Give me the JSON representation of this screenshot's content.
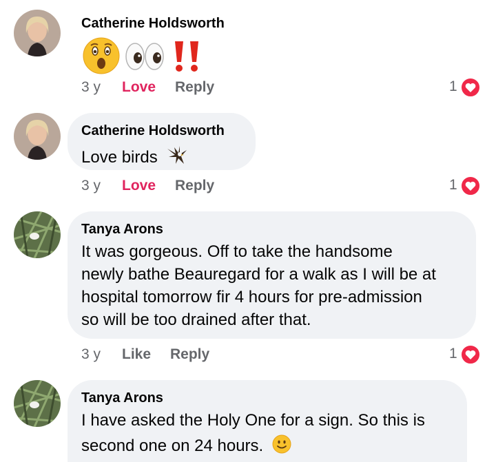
{
  "comments": [
    {
      "author": "Catherine Holdsworth",
      "text": "",
      "emoji": [
        "astonished-face",
        "eyes",
        "double-exclamation"
      ],
      "time": "3 y",
      "reaction_action": "Love",
      "reply": "Reply",
      "reaction_count": "1"
    },
    {
      "author": "Catherine Holdsworth",
      "text": "Love birds",
      "emoji": [
        "eagle"
      ],
      "time": "3 y",
      "reaction_action": "Love",
      "reply": "Reply",
      "reaction_count": "1"
    },
    {
      "author": "Tanya Arons",
      "text_lines": [
        "It was gorgeous.  Off to take the handsome",
        "newly bathe Beauregard for a walk as I will be at",
        "hospital tomorrow fir 4 hours for pre-admission",
        "so will  be too drained after that."
      ],
      "time": "3 y",
      "reaction_action": "Like",
      "reply": "Reply",
      "reaction_count": "1"
    },
    {
      "author": "Tanya Arons",
      "text_lines": [
        "I have asked the Holy One for a sign.  So this is",
        "second one on 24 hours."
      ],
      "emoji": [
        "slightly-smiling-face"
      ]
    }
  ],
  "colors": {
    "bubble": "#f0f2f5",
    "love": "#e0245e",
    "muted": "#65676b",
    "heart": "#f02849"
  }
}
